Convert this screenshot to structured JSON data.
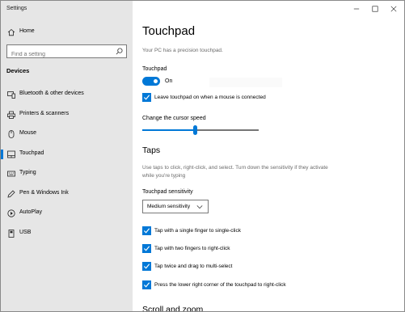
{
  "window": {
    "title": "Settings"
  },
  "sidebar": {
    "home_label": "Home",
    "search_placeholder": "Find a setting",
    "section_title": "Devices",
    "items": [
      {
        "label": "Bluetooth & other devices",
        "icon": "bluetooth-icon"
      },
      {
        "label": "Printers & scanners",
        "icon": "printer-icon"
      },
      {
        "label": "Mouse",
        "icon": "mouse-icon"
      },
      {
        "label": "Touchpad",
        "icon": "touchpad-icon",
        "selected": true
      },
      {
        "label": "Typing",
        "icon": "keyboard-icon"
      },
      {
        "label": "Pen & Windows Ink",
        "icon": "pen-icon"
      },
      {
        "label": "AutoPlay",
        "icon": "autoplay-icon"
      },
      {
        "label": "USB",
        "icon": "usb-icon"
      }
    ]
  },
  "main": {
    "title": "Touchpad",
    "precision_note": "Your PC has a precision touchpad.",
    "touchpad_label": "Touchpad",
    "toggle_state": "On",
    "toggle_on": true,
    "leave_touchpad_label": "Leave touchpad on when a mouse is connected",
    "cursor_speed_label": "Change the cursor speed",
    "cursor_speed_fraction": 0.45,
    "taps_heading": "Taps",
    "taps_description": "Use taps to click, right-click, and select. Turn down the sensitivity if they activate while you're typing",
    "sensitivity_label": "Touchpad sensitivity",
    "sensitivity_value": "Medium sensitivity",
    "tap_options": [
      {
        "label": "Tap with a single finger to single-click",
        "checked": true
      },
      {
        "label": "Tap with two fingers to right-click",
        "checked": true
      },
      {
        "label": "Tap twice and drag to multi-select",
        "checked": true
      },
      {
        "label": "Press the lower right corner of the touchpad to right-click",
        "checked": true
      }
    ],
    "scroll_heading": "Scroll and zoom"
  },
  "colors": {
    "accent": "#0078d7",
    "sidebar_bg": "#e6e6e6"
  }
}
